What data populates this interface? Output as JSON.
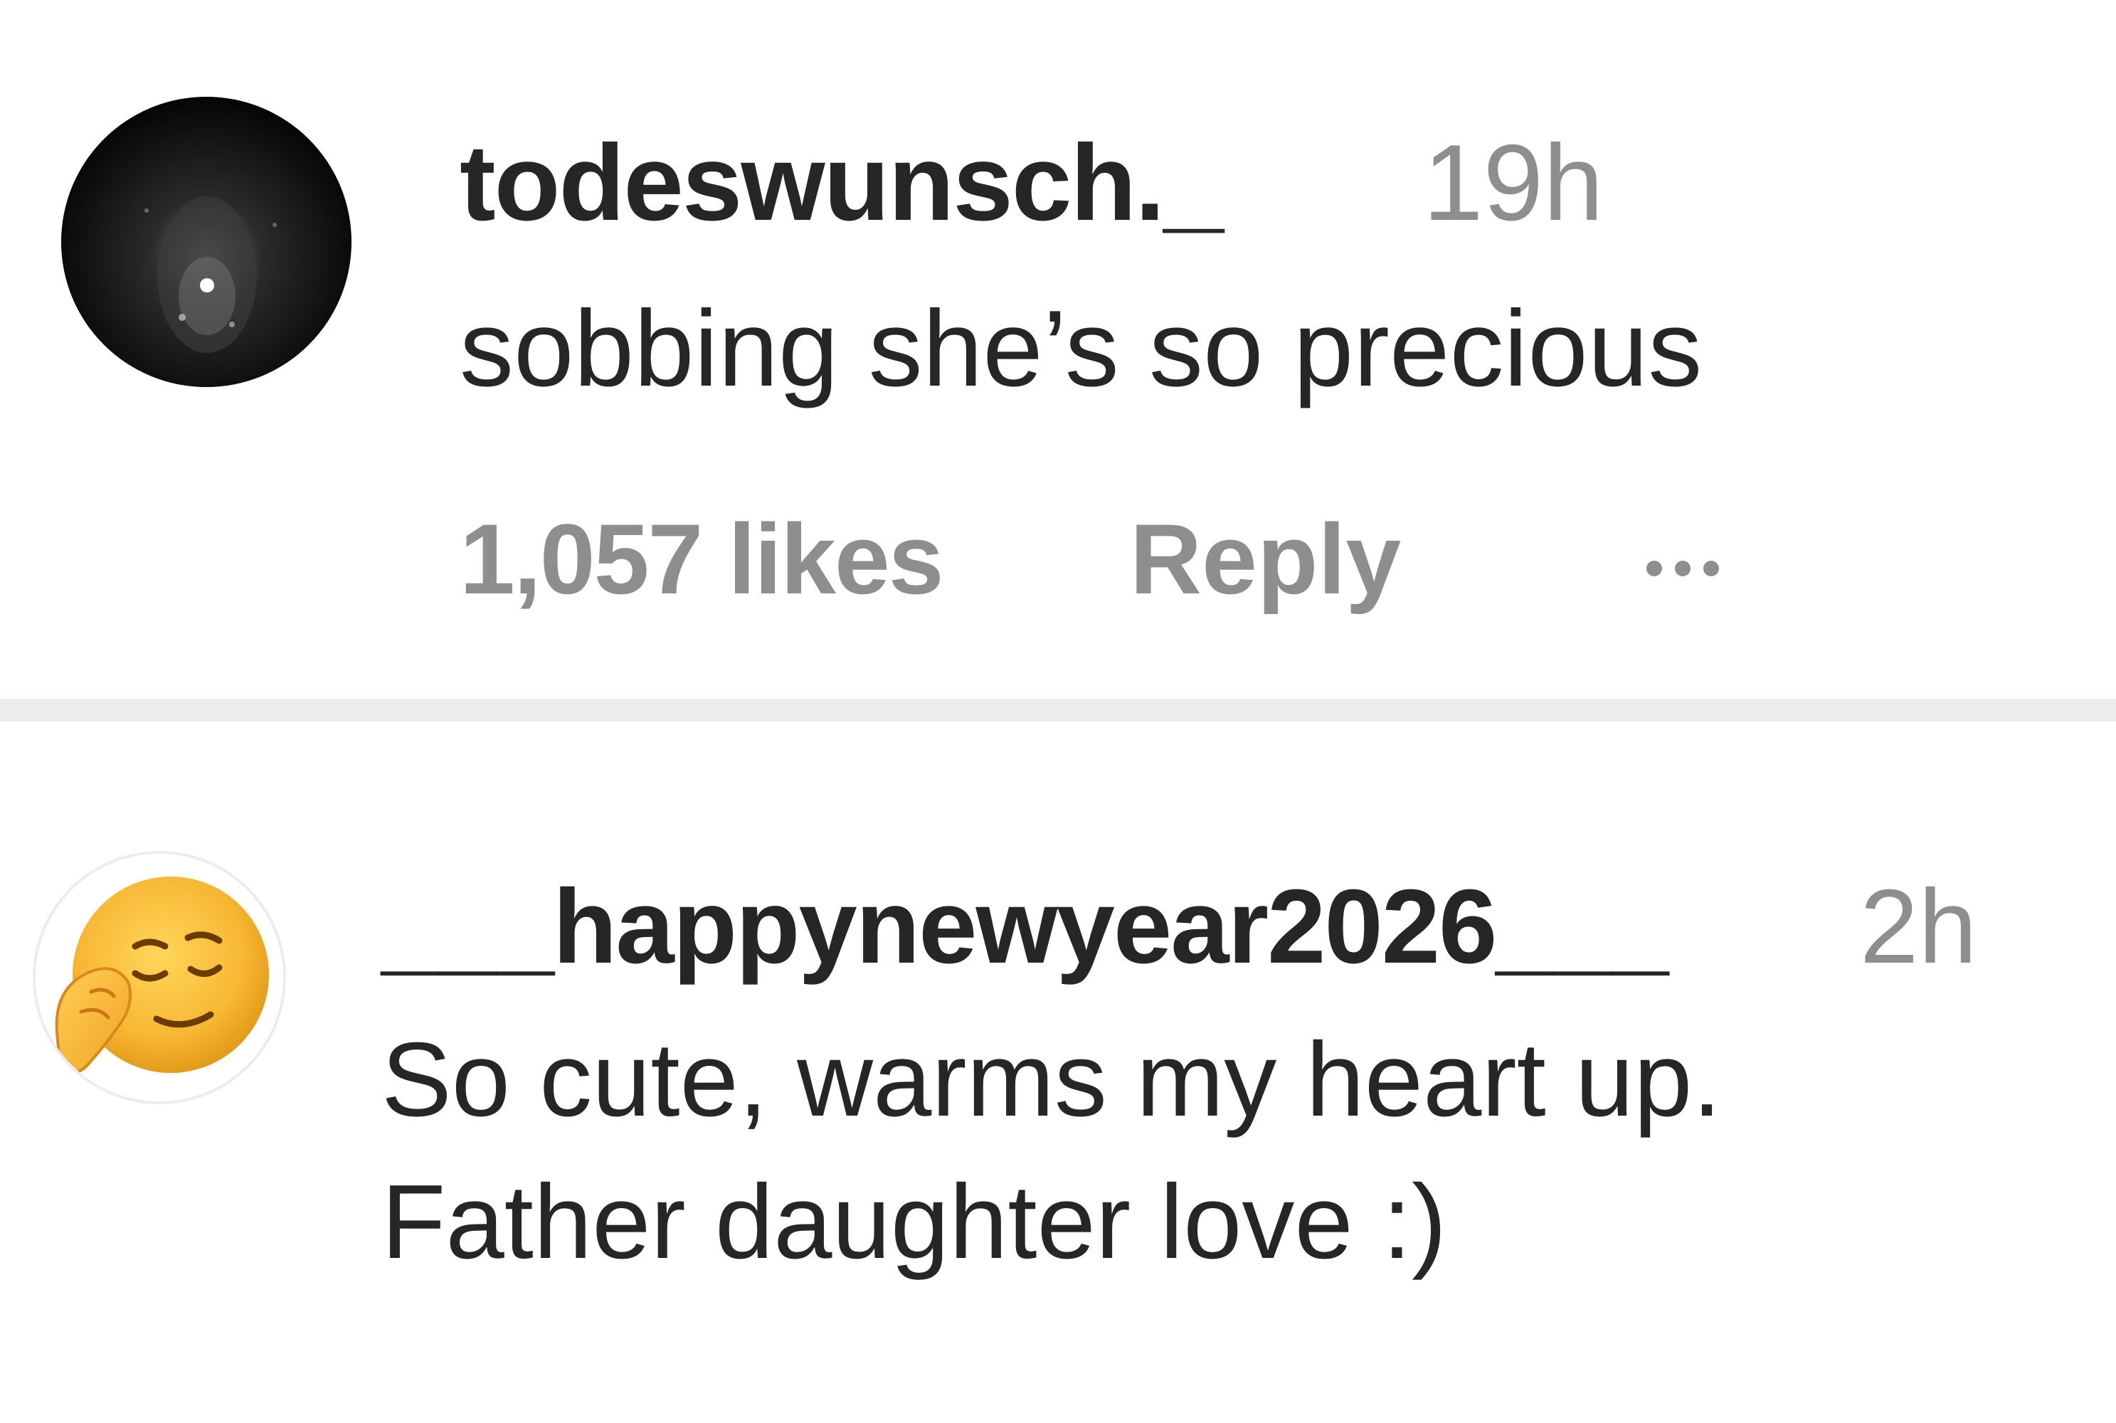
{
  "comments": [
    {
      "username": "todeswunsch._",
      "time": "19h",
      "text": "sobbing she’s so precious",
      "likes": "1,057 likes",
      "reply_label": "Reply",
      "avatar_icon": "dark-photo-avatar",
      "more_icon": "more-options-icon"
    },
    {
      "username": "___happynewyear2026___",
      "time": "2h",
      "text_line1": "So cute, warms my heart up.",
      "text_line2": "Father daughter love :)",
      "avatar_icon": "relieved-face-emoji-avatar"
    }
  ],
  "colors": {
    "primary_text": "#262626",
    "secondary_text": "#8e8e8e",
    "divider": "#ededed",
    "emoji_yellow": "#f7b733"
  }
}
